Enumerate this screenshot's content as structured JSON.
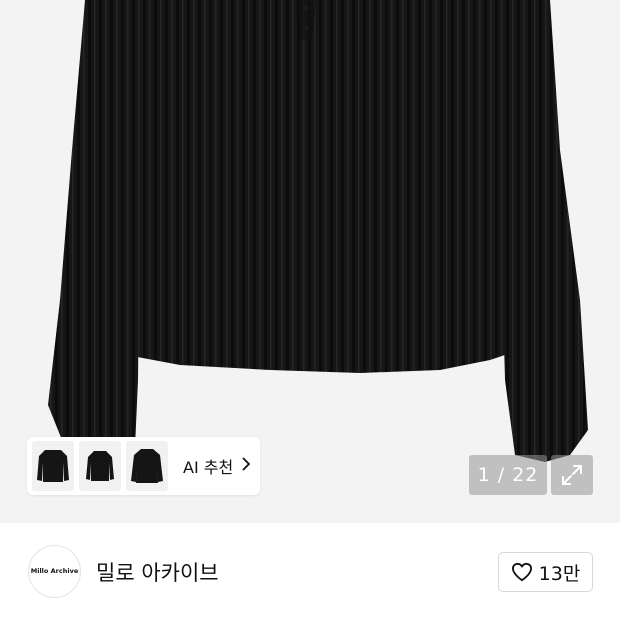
{
  "recommendation": {
    "label": "AI 추천",
    "chevron": "chevron-right-icon",
    "thumbnails": [
      "sweater-thumbnail-1",
      "sweater-thumbnail-2",
      "sweater-thumbnail-3"
    ]
  },
  "gallery": {
    "counter": "1 / 22",
    "expand_icon": "expand-icon"
  },
  "shop": {
    "logo_text": "Millo Archive",
    "name": "밀로 아카이브",
    "likes": "13만",
    "like_icon": "heart-icon"
  },
  "colors": {
    "image_bg": "#f3f3f3",
    "garment": "#141414",
    "overlay": "rgba(150,150,150,0.55)"
  }
}
